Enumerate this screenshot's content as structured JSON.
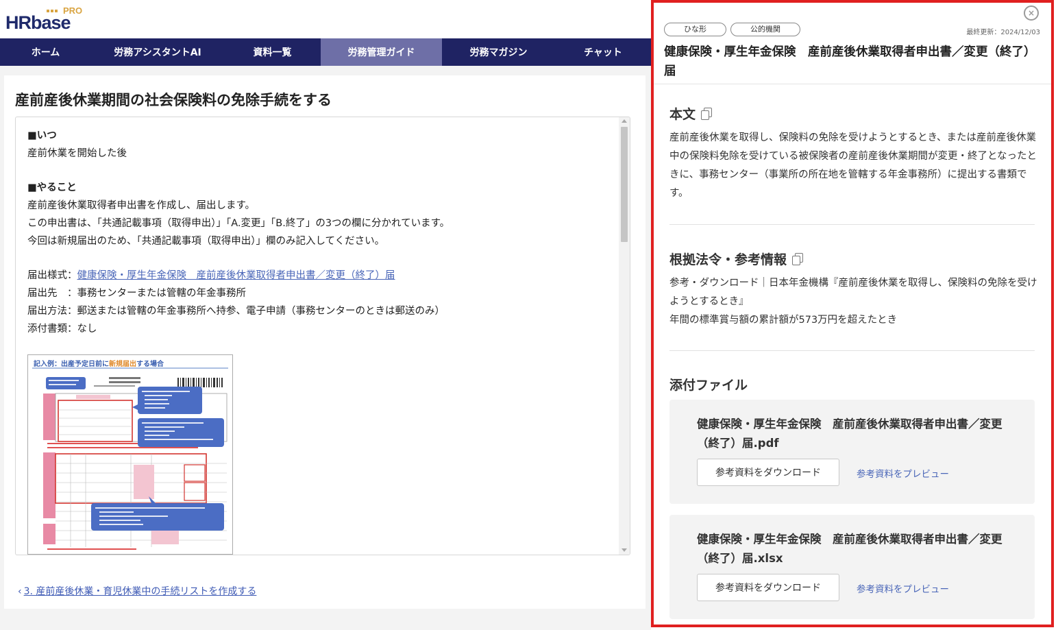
{
  "header": {
    "logo_word": "HRbase",
    "logo_pro": "PRO"
  },
  "nav": {
    "items": [
      {
        "label": "ホーム"
      },
      {
        "label": "労務アシスタントAI"
      },
      {
        "label": "資料一覧"
      },
      {
        "label": "労務管理ガイド"
      },
      {
        "label": "労務マガジン"
      },
      {
        "label": "チャット"
      }
    ],
    "active_index": 3
  },
  "main": {
    "title": "産前産後休業期間の社会保険料の免除手続をする",
    "when_head": "■いつ",
    "when_text": "産前休業を開始した後",
    "todo_head": "■やること",
    "todo_lines": [
      "産前産後休業取得者申出書を作成し、届出します。",
      "この申出書は、「共通記載事項（取得申出）」「A.変更」「B.終了」の3つの欄に分かれています。",
      "今回は新規届出のため、「共通記載事項（取得申出）」欄のみ記入してください。"
    ],
    "form_label": "届出様式：",
    "form_link": "健康保険・厚生年金保険　産前産後休業取得者申出書／変更（終了）届",
    "dest_line": "届出先　：事務センターまたは管轄の年金事務所",
    "method_line": "届出方法：郵送または管轄の年金事務所へ持参、電子申請（事務センターのときは郵送のみ）",
    "attach_line": "添付書類：なし",
    "image_heading_a": "記入例：出産予定日前に",
    "image_heading_hl": "新規届出",
    "image_heading_b": "する場合",
    "prev_link": "3. 産前産後休業・育児休業中の手続リストを作成する"
  },
  "panel": {
    "close_label": "×",
    "tags": [
      "ひな形",
      "公的機関"
    ],
    "updated": "最終更新：2024/12/03",
    "title": "健康保険・厚生年金保険　産前産後休業取得者申出書／変更（終了）届",
    "body_heading": "本文",
    "body_text": "産前産後休業を取得し、保険料の免除を受けようとするとき、または産前産後休業中の保険料免除を受けている被保険者の産前産後休業期間が変更・終了となったときに、事務センター（事業所の所在地を管轄する年金事務所）に提出する書類です。",
    "ref_heading": "根拠法令・参考情報",
    "ref_line1": "参考・ダウンロード｜日本年金機構『産前産後休業を取得し、保険料の免除を受けようとするとき』",
    "ref_line2": "年間の標準賞与額の累計額が573万円を超えたとき",
    "attach_heading": "添付ファイル",
    "files": [
      {
        "name": "健康保険・厚生年金保険　産前産後休業取得者申出書／変更（終了）届.pdf",
        "download": "参考資料をダウンロード",
        "preview": "参考資料をプレビュー"
      },
      {
        "name": "健康保険・厚生年金保険　産前産後休業取得者申出書／変更（終了）届.xlsx",
        "download": "参考資料をダウンロード",
        "preview": "参考資料をプレビュー"
      }
    ]
  },
  "colors": {
    "nav_bg": "#1f2363",
    "nav_active": "#6e6fa7",
    "link": "#4a66b8",
    "panel_border": "#e02020",
    "logo_accent": "#d9a441"
  }
}
